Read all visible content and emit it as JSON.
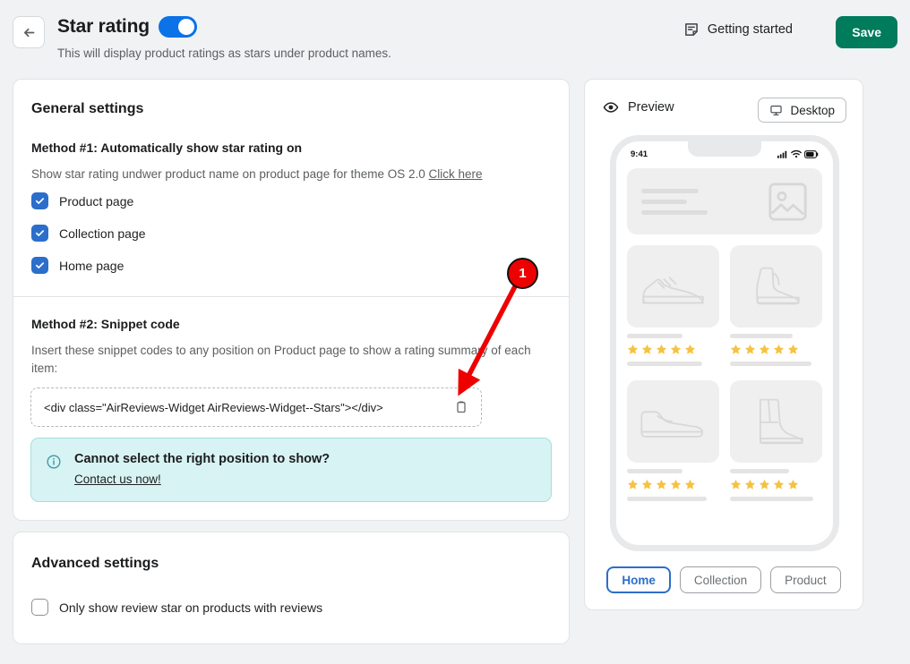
{
  "header": {
    "back_icon": "arrow-left-icon",
    "title": "Star rating",
    "toggle_state": "on",
    "subtitle": "This will display product ratings as stars under product names.",
    "getting_started_label": "Getting started",
    "getting_started_icon": "note-icon",
    "save_label": "Save",
    "save_color": "#007B5C"
  },
  "general": {
    "card_title": "General settings",
    "method1": {
      "heading": "Method #1: Automatically show star rating on",
      "description": "Show star rating undwer product name on product page for theme OS 2.0 ",
      "link_label": "Click here",
      "checkboxes": [
        {
          "label": "Product page",
          "checked": true
        },
        {
          "label": "Collection page",
          "checked": true
        },
        {
          "label": "Home page",
          "checked": true
        }
      ]
    },
    "method2": {
      "heading": "Method #2: Snippet code",
      "description": "Insert these snippet codes to any position on Product page to show a rating summary of each item:",
      "snippet_code": "<div class=\"AirReviews-Widget AirReviews-Widget--Stars\"></div>",
      "copy_icon": "clipboard-icon"
    },
    "banner": {
      "icon": "info-circle-icon",
      "title": "Cannot select the right position to show?",
      "link_label": "Contact us now!",
      "background": "#D8F3F3"
    }
  },
  "advanced": {
    "card_title": "Advanced settings",
    "checkbox": {
      "label": "Only show review star on products with reviews",
      "checked": false
    }
  },
  "preview": {
    "eye_icon": "eye-icon",
    "label": "Preview",
    "device_button": {
      "label": "Desktop",
      "icon": "desktop-icon"
    },
    "phone": {
      "status_time": "9:41",
      "status_icons": [
        "signal-icon",
        "wifi-icon",
        "battery-icon"
      ],
      "hero_icon": "image-placeholder-icon",
      "products": [
        {
          "icon": "sneaker-icon",
          "stars": 5
        },
        {
          "icon": "chelsea-boot-icon",
          "stars": 5
        },
        {
          "icon": "loafer-icon",
          "stars": 5
        },
        {
          "icon": "high-heel-boot-icon",
          "stars": 5
        }
      ],
      "star_color": "#F5C242"
    },
    "tabs": [
      {
        "label": "Home",
        "active": true
      },
      {
        "label": "Collection",
        "active": false
      },
      {
        "label": "Product",
        "active": false
      }
    ]
  },
  "annotation": {
    "badge_number": "1",
    "badge_color": "#EE0000",
    "arrow_color": "#EE0000"
  }
}
